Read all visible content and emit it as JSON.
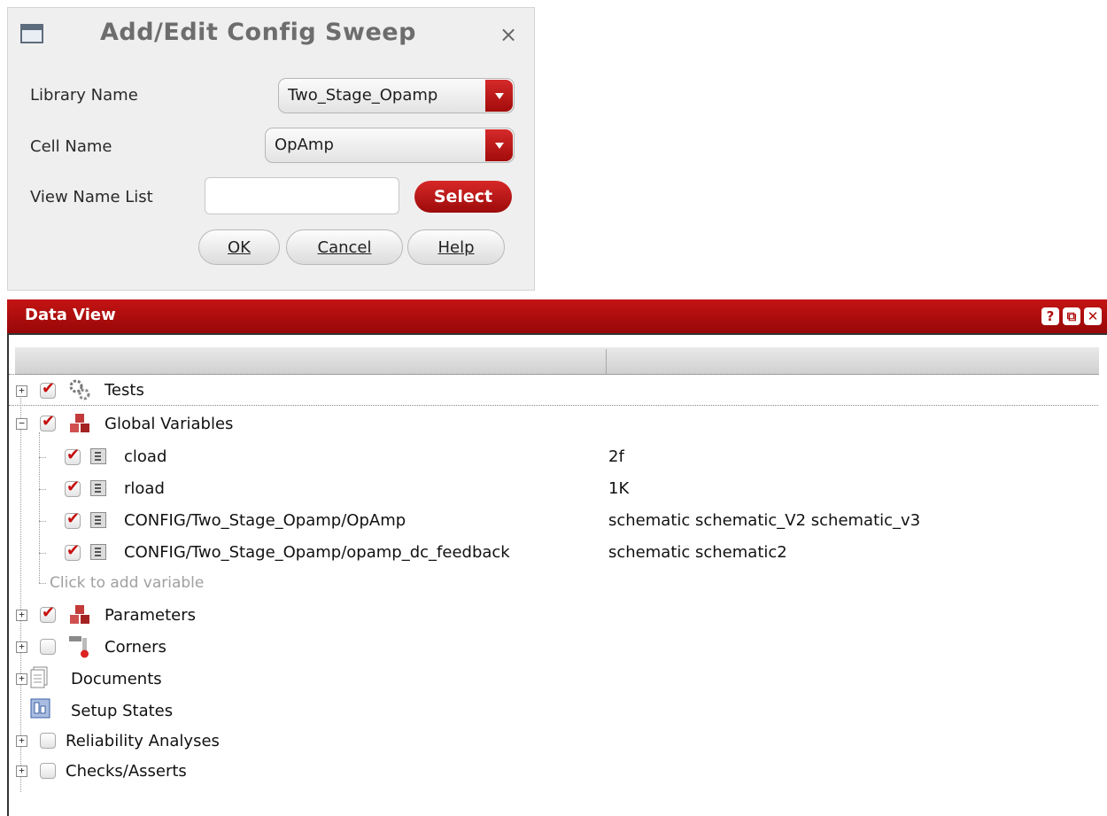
{
  "dialog": {
    "title": "Add/Edit Config Sweep",
    "close_glyph": "×",
    "library_label": "Library Name",
    "library_value": "Two_Stage_Opamp",
    "cell_label": "Cell Name",
    "cell_value": "OpAmp",
    "view_label": "View Name List",
    "view_value": "",
    "select_label": "Select",
    "ok_label": "OK",
    "cancel_label": "Cancel",
    "help_label": "Help",
    "accent_color": "#c31515"
  },
  "data_view": {
    "title": "Data View",
    "icons": {
      "help": "?",
      "restore": "⧉",
      "close": "✕"
    },
    "tree": {
      "tests": {
        "label": "Tests",
        "checked": true,
        "expanded": false
      },
      "global_variables": {
        "label": "Global Variables",
        "checked": true,
        "expanded": true,
        "items": [
          {
            "name": "cload",
            "value": "2f",
            "checked": true
          },
          {
            "name": "rload",
            "value": "1K",
            "checked": true
          },
          {
            "name": "CONFIG/Two_Stage_Opamp/OpAmp",
            "value": "schematic schematic_V2 schematic_v3",
            "checked": true
          },
          {
            "name": "CONFIG/Two_Stage_Opamp/opamp_dc_feedback",
            "value": "schematic schematic2",
            "checked": true
          }
        ],
        "add_placeholder": "Click to add variable"
      },
      "parameters": {
        "label": "Parameters",
        "checked": true
      },
      "corners": {
        "label": "Corners",
        "checked": false
      },
      "documents": {
        "label": "Documents"
      },
      "setup_states": {
        "label": "Setup States"
      },
      "reliability": {
        "label": "Reliability Analyses",
        "checked": false
      },
      "checks": {
        "label": "Checks/Asserts",
        "checked": false
      }
    }
  }
}
